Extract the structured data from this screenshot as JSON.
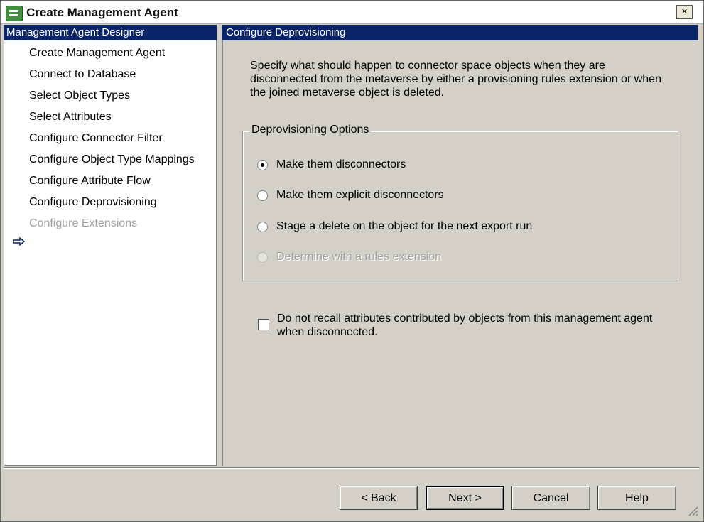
{
  "window": {
    "title": "Create Management Agent",
    "close_label": "×"
  },
  "left_panel": {
    "header": "Management Agent Designer",
    "items": [
      {
        "label": "Create Management Agent",
        "state": "normal"
      },
      {
        "label": "Connect to Database",
        "state": "normal"
      },
      {
        "label": "Select Object Types",
        "state": "normal"
      },
      {
        "label": "Select Attributes",
        "state": "normal"
      },
      {
        "label": "Configure Connector Filter",
        "state": "normal"
      },
      {
        "label": "Configure Object Type Mappings",
        "state": "normal"
      },
      {
        "label": "Configure Attribute Flow",
        "state": "normal"
      },
      {
        "label": "Configure Deprovisioning",
        "state": "current"
      },
      {
        "label": "Configure Extensions",
        "state": "disabled"
      }
    ]
  },
  "right_panel": {
    "header": "Configure Deprovisioning",
    "description": "Specify what should happen to connector space objects when they are disconnected from the metaverse by either a provisioning rules extension or when the joined metaverse object is deleted.",
    "group_title": "Deprovisioning Options",
    "options": [
      {
        "label": "Make them disconnectors",
        "selected": true,
        "enabled": true
      },
      {
        "label": "Make them explicit disconnectors",
        "selected": false,
        "enabled": true
      },
      {
        "label": "Stage a delete on the object for the next export run",
        "selected": false,
        "enabled": true
      },
      {
        "label": "Determine with a rules extension",
        "selected": false,
        "enabled": false
      }
    ],
    "checkbox": {
      "label": "Do not recall attributes contributed by objects from this management agent when disconnected.",
      "checked": false
    }
  },
  "buttons": {
    "back": "< Back",
    "next": "Next >",
    "cancel": "Cancel",
    "help": "Help"
  },
  "colors": {
    "header_bg": "#0a246a",
    "header_text": "#ffffff",
    "dialog_bg": "#d4d0c8",
    "disabled_text": "#a0a0a0"
  }
}
